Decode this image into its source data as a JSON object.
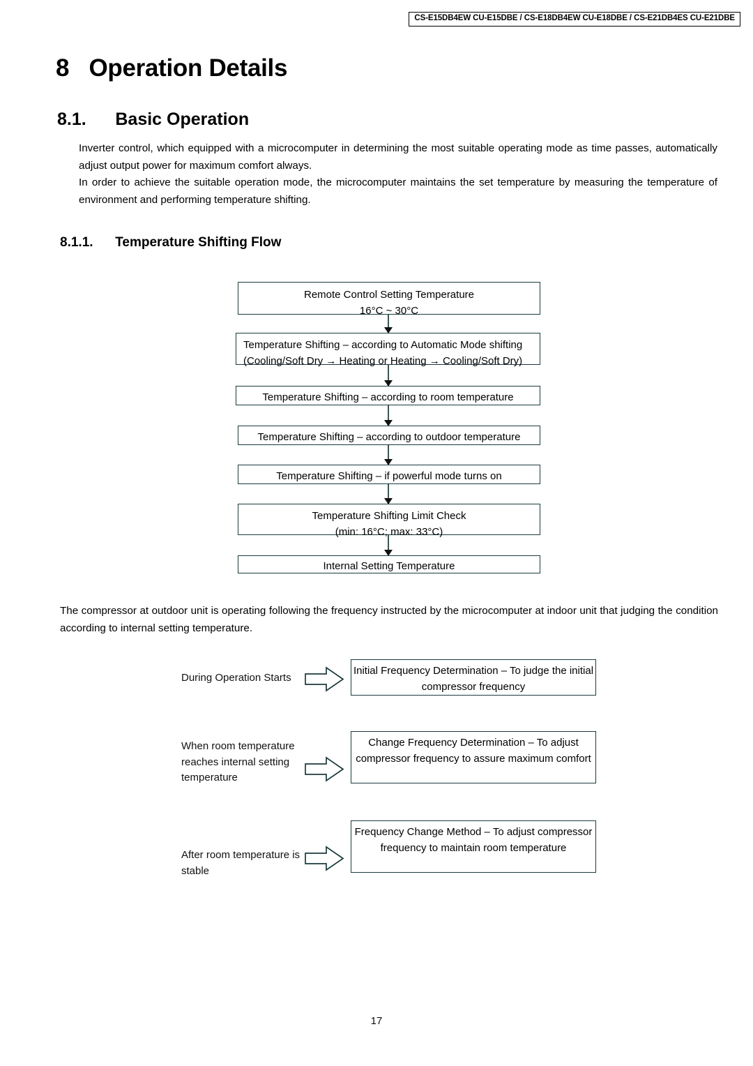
{
  "header": {
    "model_line": "CS-E15DB4EW CU-E15DBE / CS-E18DB4EW CU-E18DBE / CS-E21DB4ES CU-E21DBE"
  },
  "chapter": {
    "title": "8   Operation Details"
  },
  "section": {
    "title": "8.1.      Basic Operation"
  },
  "paragraphs": {
    "intro_1": "Inverter control, which equipped with a microcomputer in determining the most suitable operating mode as time passes, automatically adjust output power for maximum comfort always.",
    "intro_2": "In order to achieve the suitable operation mode, the microcomputer maintains the set temperature by measuring the temperature of environment and performing temperature shifting.",
    "compressor": "The compressor at outdoor unit is operating following the frequency instructed by the microcomputer at indoor unit that judging the condition according to internal setting temperature."
  },
  "subsection": {
    "title": "8.1.1.      Temperature Shifting Flow"
  },
  "temperature_shifting_flow": {
    "steps": [
      {
        "align": "center",
        "line1": "Remote Control Setting Temperature",
        "line2": "16°C ~ 30°C"
      },
      {
        "align": "left",
        "line1": "Temperature Shifting – according to Automatic Mode shifting",
        "line2": "(Cooling/Soft Dry → Heating or Heating → Cooling/Soft Dry)"
      },
      {
        "align": "center",
        "line1": "Temperature Shifting – according to room temperature",
        "line2": ""
      },
      {
        "align": "center",
        "line1": "Temperature Shifting – according to outdoor temperature",
        "line2": ""
      },
      {
        "align": "center",
        "line1": "Temperature Shifting – if powerful mode turns on",
        "line2": ""
      },
      {
        "align": "center",
        "line1": "Temperature Shifting Limit Check",
        "line2": "(min: 16°C; max: 33°C)"
      },
      {
        "align": "center",
        "line1": "Internal Setting Temperature",
        "line2": ""
      }
    ]
  },
  "frequency_control_flow": {
    "rows": [
      {
        "condition": "During Operation Starts",
        "box_line1": "Initial Frequency Determination –",
        "box_line2": "To judge the initial compressor frequency",
        "box_line3": ""
      },
      {
        "condition": "When room temperature reaches internal setting temperature",
        "box_line1": "Change Frequency Determination –",
        "box_line2": "To adjust compressor frequency to assure",
        "box_line3": "maximum comfort"
      },
      {
        "condition": "After room temperature is stable",
        "box_line1": "Frequency Change Method –",
        "box_line2": "To adjust compressor frequency to maintain",
        "box_line3": "room temperature"
      }
    ]
  },
  "footer": {
    "page_number": "17"
  },
  "colors": {
    "box_border": "#1b3a3c",
    "connector": "#3d5554",
    "text": "#000000"
  }
}
